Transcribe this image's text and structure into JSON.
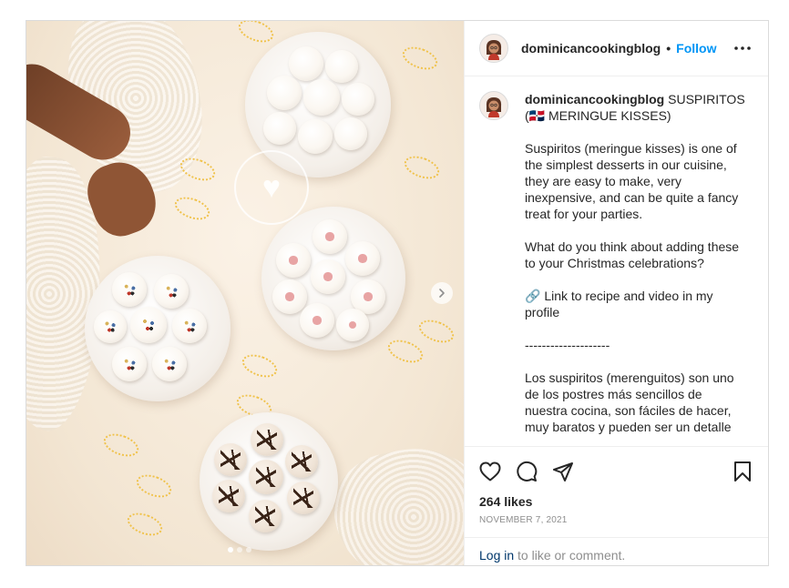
{
  "post": {
    "username": "dominicancookingblog",
    "follow_label": "Follow",
    "bullet": "•",
    "image_alt": "Meringue kisses on plates",
    "carousel": {
      "slides": 3,
      "active_index": 0
    }
  },
  "caption": {
    "username": "dominicancookingblog",
    "paragraphs": [
      " SUSPIRITOS (🇩🇴 MERINGUE KISSES)",
      "Suspiritos (meringue kisses) is one of the simplest desserts in our cuisine, they are easy to make, very inexpensive, and can be quite a fancy treat for your parties.",
      "What do you think about adding these to your Christmas celebrations?",
      "🔗 Link to recipe and video in my profile",
      "--------------------",
      "Los suspiritos (merenguitos) son uno de los postres más sencillos de nuestra cocina, son fáciles de hacer, muy baratos y pueden ser un detalle"
    ]
  },
  "stats": {
    "likes": "264 likes",
    "date": "NOVEMBER 7, 2021"
  },
  "footer": {
    "login_label": "Log in",
    "suffix": " to like or comment."
  },
  "icons": {
    "like": "heart-icon",
    "comment": "comment-icon",
    "share": "paper-plane-icon",
    "save": "bookmark-icon",
    "more": "more-icon",
    "next": "chevron-right-icon"
  },
  "colors": {
    "follow": "#0095f6",
    "login": "#00376b",
    "muted": "#8e8e8e",
    "border": "#dbdbdb"
  }
}
